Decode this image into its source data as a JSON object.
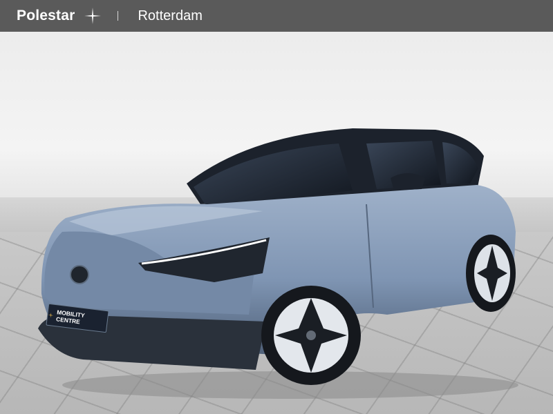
{
  "header": {
    "brand": "Polestar",
    "brand_icon": "polestar-star-icon",
    "location": "Rotterdam"
  },
  "photo": {
    "plate_text": "MOBILITY CENTRE",
    "plate_icon": "polestar-star-icon"
  },
  "colors": {
    "header_bg": "#5a5a5a",
    "car_body": "#7f95b3"
  }
}
